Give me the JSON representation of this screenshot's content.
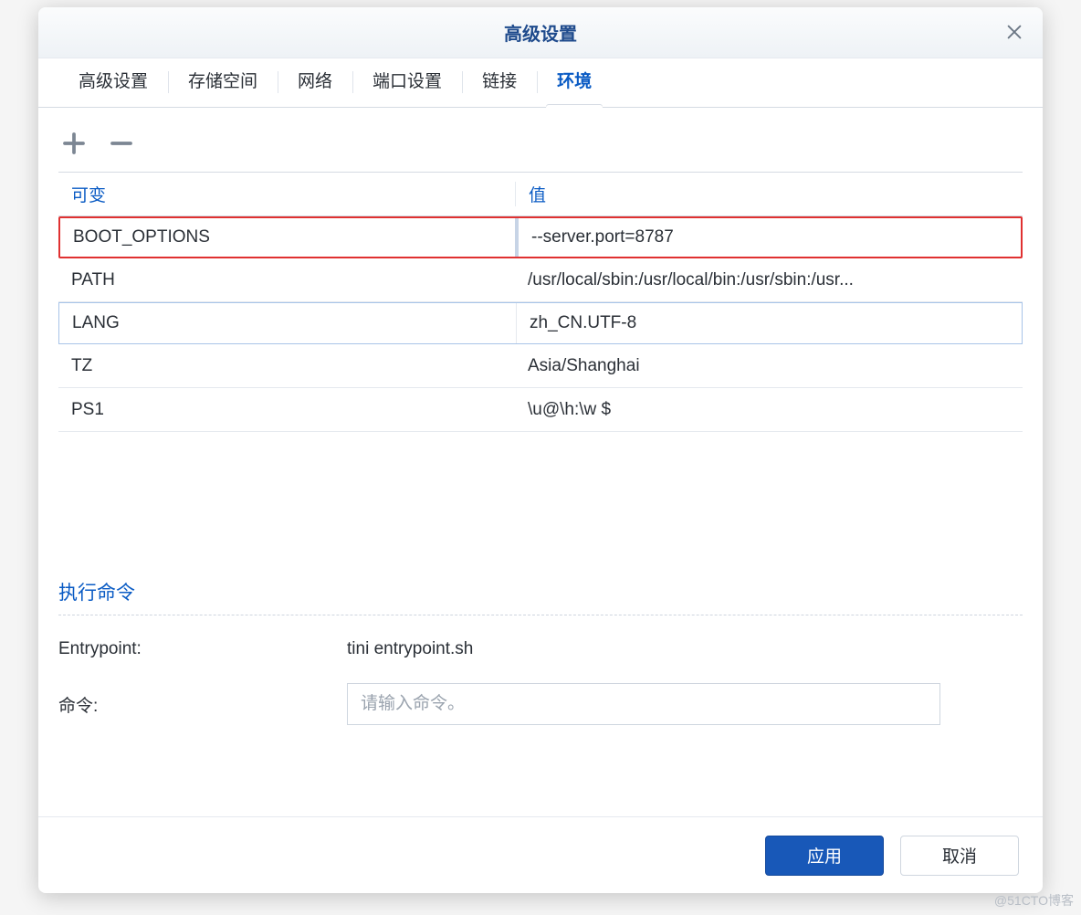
{
  "dialog": {
    "title": "高级设置"
  },
  "tabs": [
    {
      "label": "高级设置",
      "active": false
    },
    {
      "label": "存储空间",
      "active": false
    },
    {
      "label": "网络",
      "active": false
    },
    {
      "label": "端口设置",
      "active": false
    },
    {
      "label": "链接",
      "active": false
    },
    {
      "label": "环境",
      "active": true
    }
  ],
  "env_table": {
    "headers": {
      "variable": "可变",
      "value": "值"
    },
    "rows": [
      {
        "variable": "BOOT_OPTIONS",
        "value": "--server.port=8787",
        "highlight": "red"
      },
      {
        "variable": "PATH",
        "value": "/usr/local/sbin:/usr/local/bin:/usr/sbin:/usr...",
        "highlight": "none"
      },
      {
        "variable": "LANG",
        "value": "zh_CN.UTF-8",
        "highlight": "blue"
      },
      {
        "variable": "TZ",
        "value": "Asia/Shanghai",
        "highlight": "none"
      },
      {
        "variable": "PS1",
        "value": "\\u@\\h:\\w $",
        "highlight": "none"
      }
    ]
  },
  "exec": {
    "section_title": "执行命令",
    "entrypoint_label": "Entrypoint:",
    "entrypoint_value": "tini entrypoint.sh",
    "command_label": "命令:",
    "command_placeholder": "请输入命令。",
    "command_value": ""
  },
  "buttons": {
    "apply": "应用",
    "cancel": "取消"
  },
  "watermark": "@51CTO博客"
}
